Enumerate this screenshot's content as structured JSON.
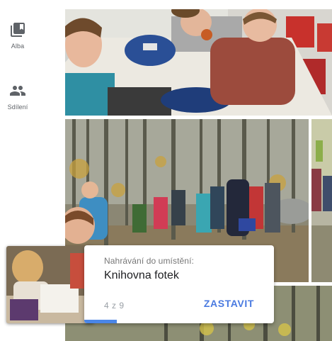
{
  "nav": {
    "items": [
      {
        "id": "albums",
        "label": "Alba",
        "icon": "album-icon"
      },
      {
        "id": "sharing",
        "label": "Sdílení",
        "icon": "people-icon"
      }
    ]
  },
  "upload": {
    "destination_label": "Nahrávání do umístění:",
    "destination_name": "Knihovna fotek",
    "count": "4 z 9",
    "stop_label": "ZASTAVIT",
    "progress_fraction": 0.17,
    "accent_color": "#4a7ae0"
  }
}
